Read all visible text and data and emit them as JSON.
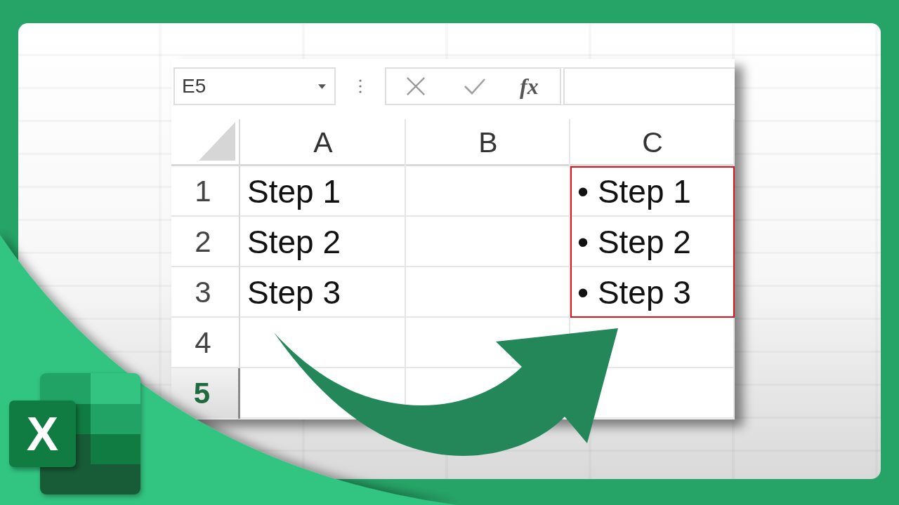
{
  "name_box": {
    "value": "E5"
  },
  "formula_bar": {
    "function_label": "fx"
  },
  "sheet": {
    "columns": [
      {
        "label": "A"
      },
      {
        "label": "B"
      },
      {
        "label": "C"
      }
    ],
    "rows": [
      {
        "label": "1",
        "selected": false,
        "cells": [
          {
            "text": "Step 1",
            "highlighted": false
          },
          {
            "highlighted": false
          },
          {
            "text": "• Step 1",
            "highlighted": true
          }
        ]
      },
      {
        "label": "2",
        "selected": false,
        "cells": [
          {
            "text": "Step 2",
            "highlighted": false
          },
          {
            "highlighted": false
          },
          {
            "text": "• Step 2",
            "highlighted": true
          }
        ]
      },
      {
        "label": "3",
        "selected": false,
        "cells": [
          {
            "text": "Step 3",
            "highlighted": false
          },
          {
            "highlighted": false
          },
          {
            "text": "• Step 3",
            "highlighted": true
          }
        ]
      },
      {
        "label": "4",
        "selected": false,
        "cells": [
          {
            "highlighted": false
          },
          {
            "highlighted": false
          },
          {
            "highlighted": false
          }
        ]
      },
      {
        "label": "5",
        "selected": true,
        "cells": [
          {
            "highlighted": false
          },
          {
            "highlighted": false
          },
          {
            "highlighted": false
          }
        ]
      }
    ]
  },
  "logo": {
    "letter": "X"
  }
}
